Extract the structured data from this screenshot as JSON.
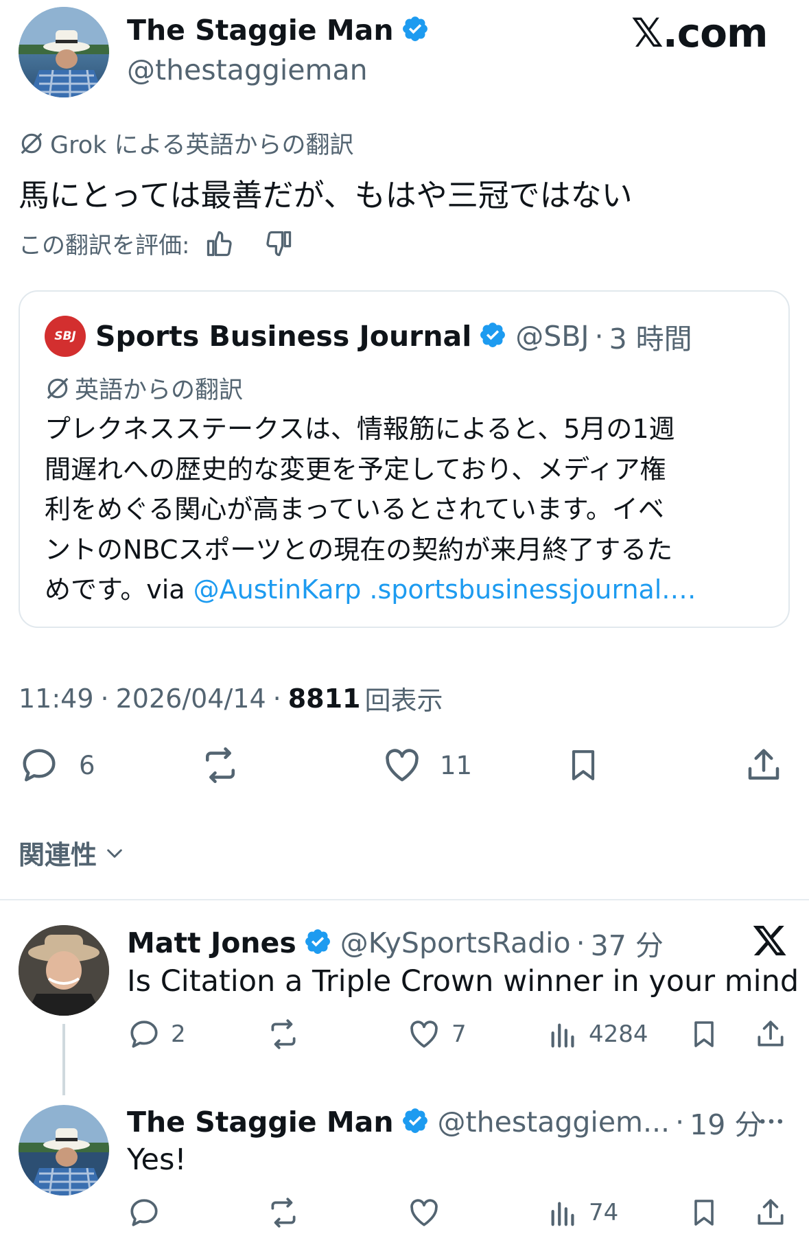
{
  "watermark": {
    "text": "𝕏.com"
  },
  "main_tweet": {
    "author_name": "The Staggie Man",
    "author_handle": "@thestaggieman",
    "translation_label": "Grok による英語からの翻訳",
    "text": "馬にとっては最善だが、もはや三冠ではない",
    "rate_label": "この翻訳を評価:",
    "quote": {
      "logo_text": "SBJ",
      "author_name": "Sports Business Journal",
      "author_handle": "@SBJ",
      "separator": "·",
      "time": "3 時間",
      "translation_label": "英語からの翻訳",
      "lines": [
        "プレクネスステークスは、情報筋によると、5月の1週",
        "間遅れへの歴史的な変更を予定しており、メディア権",
        "利をめぐる関心が高まっているとされています。イベ",
        "ントのNBCスポーツとの現在の契約が来月終了するた"
      ],
      "last_line_prefix": "めです。via ",
      "mention": "@AustinKarp",
      "link": " .sportsbusinessjournal.…"
    },
    "meta": {
      "time": "11:49",
      "separator": "·",
      "date": "2026/04/14",
      "views": "8811",
      "views_label": "回表示"
    },
    "actions": {
      "replies": "6",
      "reposts": "",
      "likes": "11"
    }
  },
  "sort": {
    "label": "関連性"
  },
  "replies": [
    {
      "author_name": "Matt Jones",
      "author_handle": "@KySportsRadio",
      "separator": "·",
      "time": "37 分",
      "text": "Is Citation a Triple Crown winner in your mind",
      "actions": {
        "replies": "2",
        "reposts": "",
        "likes": "7",
        "views": "4284"
      }
    },
    {
      "author_name": "The Staggie Man",
      "author_handle": "@thestaggiem...",
      "separator": "·",
      "time": "19 分",
      "text": "Yes!",
      "actions": {
        "replies": "",
        "reposts": "",
        "likes": "",
        "views": "74"
      }
    }
  ],
  "colors": {
    "accent": "#1d9bf0",
    "text": "#0f1419",
    "secondary": "#536471",
    "border": "#cfd9de",
    "sbj_red": "#d32f2f"
  }
}
